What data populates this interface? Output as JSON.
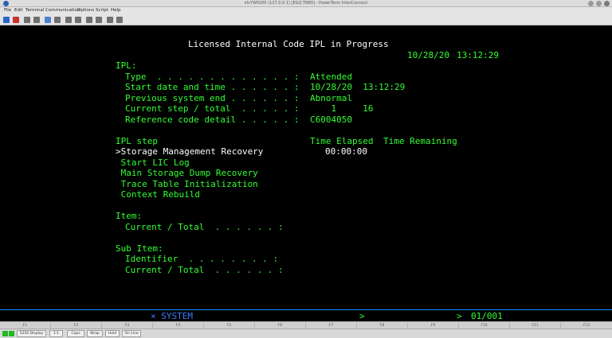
{
  "window": {
    "title": "sfs7W0200 (127.0.0.1) [EGO.TN80] - PowerTerm InterConnect"
  },
  "menubar": {
    "items": [
      "File",
      "Edit",
      "Terminal",
      "Communication",
      "Options",
      "Script",
      "Help"
    ]
  },
  "terminal": {
    "screen_title": "Licensed Internal Code IPL in Progress",
    "header_date": "10/28/20",
    "header_time": "13:12:29",
    "ipl_label": "IPL:",
    "fields": [
      {
        "label": "Type  . . . . . . . . . . . . . :",
        "value": "Attended"
      },
      {
        "label": "Start date and time . . . . . . :",
        "value": "10/28/20  13:12:29"
      },
      {
        "label": "Previous system end . . . . . . :",
        "value": "Abnormal"
      },
      {
        "label": "Current step / total  . . . . . :",
        "value": "    1     16"
      },
      {
        "label": "Reference code detail . . . . . :",
        "value": "C6004050"
      }
    ],
    "step_header": "IPL step",
    "time_elapsed_header": "Time Elapsed",
    "time_remaining_header": "Time Remaining",
    "steps": [
      ">Storage Management Recovery",
      " Start LIC Log",
      " Main Storage Dump Recovery",
      " Trace Table Initialization",
      " Context Rebuild"
    ],
    "current_elapsed": "00:00:00",
    "item_label": "Item:",
    "item_current_total": "Current / Total  . . . . . . :",
    "subitem_label": "Sub Item:",
    "subitem_identifier": "Identifier  . . . . . . . . :",
    "subitem_current_total": "Current / Total  . . . . . . :"
  },
  "oia": {
    "system": "× SYSTEM",
    "arrow1": ">",
    "arrow2": ">",
    "position": "01/001"
  },
  "fkeys": [
    "F1",
    "F2",
    "F3",
    "F4",
    "F5",
    "F6",
    "F7",
    "F8",
    "F9",
    "F10",
    "F11",
    "F12"
  ],
  "statusbar": {
    "display": "5250 Display",
    "ratio": "1:1",
    "caps": "Caps",
    "wrap": "Wrap",
    "hold": "Hold",
    "online": "On Line"
  },
  "colors": {
    "terminal_bg": "#000000",
    "text_green": "#33ff33",
    "text_white": "#ffffff",
    "oia_blue": "#3d7bff"
  }
}
